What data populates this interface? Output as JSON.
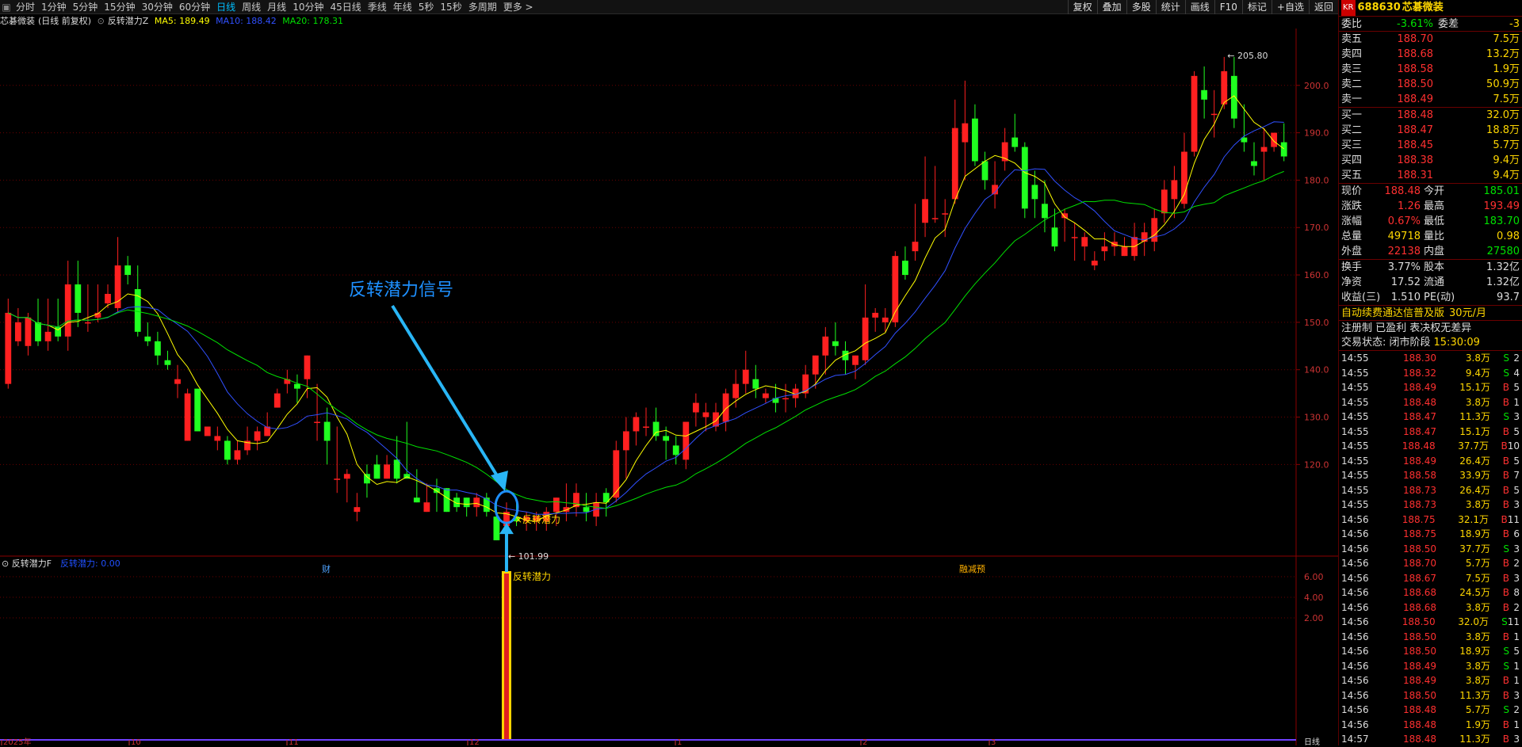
{
  "toolbar": {
    "timeframes": [
      "分时",
      "1分钟",
      "5分钟",
      "15分钟",
      "30分钟",
      "60分钟",
      "日线",
      "周线",
      "月线",
      "10分钟",
      "45日线",
      "季线",
      "年线",
      "5秒",
      "15秒",
      "多周期",
      "更多 >"
    ],
    "active_timeframe": "日线",
    "tools": [
      "复权",
      "叠加",
      "多股",
      "统计",
      "画线",
      "F10",
      "标记",
      "+自选",
      "返回"
    ]
  },
  "legend": {
    "stock_name": "芯碁微装",
    "mode": "(日线 前复权)",
    "indicator": "反转潜力Z",
    "ma5_label": "MA5: 189.49",
    "ma10_label": "MA10: 188.42",
    "ma20_label": "MA20: 178.31",
    "ma5_color": "#ffff00",
    "ma10_color": "#3050ff",
    "ma20_color": "#00e000"
  },
  "chart_data": {
    "type": "candlestick",
    "y_ticks": [
      "200.0",
      "190.0",
      "180.0",
      "170.0",
      "160.0",
      "150.0",
      "140.0",
      "130.0",
      "120.0"
    ],
    "ylim": [
      101,
      212
    ],
    "up_color": "#ff2020",
    "down_color": "#20ff20",
    "candles": [
      {
        "o": 137,
        "h": 155,
        "l": 136,
        "c": 152
      },
      {
        "o": 146,
        "h": 153,
        "l": 145,
        "c": 150
      },
      {
        "o": 145,
        "h": 152,
        "l": 143,
        "c": 151
      },
      {
        "o": 150,
        "h": 155,
        "l": 145,
        "c": 146
      },
      {
        "o": 146,
        "h": 155,
        "l": 144,
        "c": 148
      },
      {
        "o": 149,
        "h": 155,
        "l": 146,
        "c": 147
      },
      {
        "o": 147,
        "h": 163,
        "l": 144,
        "c": 158
      },
      {
        "o": 158,
        "h": 163,
        "l": 149,
        "c": 152
      },
      {
        "o": 150,
        "h": 158,
        "l": 148,
        "c": 150
      },
      {
        "o": 151,
        "h": 158,
        "l": 150,
        "c": 152
      },
      {
        "o": 154,
        "h": 158,
        "l": 153,
        "c": 156
      },
      {
        "o": 153,
        "h": 168,
        "l": 152,
        "c": 162
      },
      {
        "o": 162,
        "h": 164,
        "l": 158,
        "c": 160
      },
      {
        "o": 157,
        "h": 162,
        "l": 147,
        "c": 148
      },
      {
        "o": 147,
        "h": 150,
        "l": 145,
        "c": 146
      },
      {
        "o": 146,
        "h": 148,
        "l": 141,
        "c": 143
      },
      {
        "o": 142,
        "h": 144,
        "l": 140,
        "c": 141
      },
      {
        "o": 137,
        "h": 141,
        "l": 134,
        "c": 138
      },
      {
        "o": 125,
        "h": 136,
        "l": 125,
        "c": 135
      },
      {
        "o": 136,
        "h": 136,
        "l": 127,
        "c": 127
      },
      {
        "o": 126,
        "h": 128,
        "l": 127,
        "c": 128
      },
      {
        "o": 125,
        "h": 128,
        "l": 123,
        "c": 126
      },
      {
        "o": 125,
        "h": 126,
        "l": 120,
        "c": 121
      },
      {
        "o": 121,
        "h": 125,
        "l": 120,
        "c": 123
      },
      {
        "o": 123,
        "h": 128,
        "l": 122,
        "c": 125
      },
      {
        "o": 125,
        "h": 128,
        "l": 123,
        "c": 127
      },
      {
        "o": 126,
        "h": 131,
        "l": 126,
        "c": 128
      },
      {
        "o": 132,
        "h": 136,
        "l": 132,
        "c": 135
      },
      {
        "o": 137,
        "h": 140,
        "l": 135,
        "c": 138
      },
      {
        "o": 137,
        "h": 139,
        "l": 133,
        "c": 136
      },
      {
        "o": 138,
        "h": 143,
        "l": 134,
        "c": 143
      },
      {
        "o": 129,
        "h": 137,
        "l": 125,
        "c": 129
      },
      {
        "o": 129,
        "h": 132,
        "l": 120,
        "c": 125
      },
      {
        "o": 117,
        "h": 128,
        "l": 114,
        "c": 117
      },
      {
        "o": 117,
        "h": 119,
        "l": 112,
        "c": 118
      },
      {
        "o": 110,
        "h": 114,
        "l": 108,
        "c": 111
      },
      {
        "o": 118,
        "h": 120,
        "l": 113,
        "c": 116
      },
      {
        "o": 120,
        "h": 122,
        "l": 117,
        "c": 117
      },
      {
        "o": 117,
        "h": 122,
        "l": 117,
        "c": 120
      },
      {
        "o": 121,
        "h": 126,
        "l": 116,
        "c": 117
      },
      {
        "o": 118,
        "h": 129,
        "l": 117,
        "c": 117
      },
      {
        "o": 113,
        "h": 119,
        "l": 112,
        "c": 112
      },
      {
        "o": 110,
        "h": 116,
        "l": 110,
        "c": 112
      },
      {
        "o": 115,
        "h": 117,
        "l": 110,
        "c": 114
      },
      {
        "o": 115,
        "h": 115,
        "l": 110,
        "c": 110
      },
      {
        "o": 113,
        "h": 114,
        "l": 110,
        "c": 111
      },
      {
        "o": 113,
        "h": 113,
        "l": 109,
        "c": 111
      },
      {
        "o": 111,
        "h": 114,
        "l": 109,
        "c": 113
      },
      {
        "o": 113,
        "h": 114,
        "l": 109,
        "c": 110
      },
      {
        "o": 109,
        "h": 112,
        "l": 104,
        "c": 104
      },
      {
        "o": 107,
        "h": 112,
        "l": 102,
        "c": 110
      },
      {
        "o": 109,
        "h": 112,
        "l": 107,
        "c": 108
      },
      {
        "o": 108,
        "h": 110,
        "l": 106,
        "c": 109
      },
      {
        "o": 108,
        "h": 110,
        "l": 106,
        "c": 109
      },
      {
        "o": 108,
        "h": 111,
        "l": 106,
        "c": 110
      },
      {
        "o": 110,
        "h": 113,
        "l": 107,
        "c": 113
      },
      {
        "o": 110,
        "h": 116,
        "l": 108,
        "c": 111
      },
      {
        "o": 111,
        "h": 116,
        "l": 109,
        "c": 114
      },
      {
        "o": 111,
        "h": 114,
        "l": 108,
        "c": 110
      },
      {
        "o": 109,
        "h": 114,
        "l": 107,
        "c": 112
      },
      {
        "o": 114,
        "h": 115,
        "l": 109,
        "c": 112
      },
      {
        "o": 113,
        "h": 125,
        "l": 112,
        "c": 123
      },
      {
        "o": 123,
        "h": 130,
        "l": 117,
        "c": 127
      },
      {
        "o": 127,
        "h": 131,
        "l": 124,
        "c": 130
      },
      {
        "o": 128,
        "h": 132,
        "l": 126,
        "c": 128
      },
      {
        "o": 129,
        "h": 132,
        "l": 125,
        "c": 126
      },
      {
        "o": 126,
        "h": 128,
        "l": 121,
        "c": 125
      },
      {
        "o": 124,
        "h": 126,
        "l": 120,
        "c": 122
      },
      {
        "o": 121,
        "h": 127,
        "l": 119,
        "c": 129
      },
      {
        "o": 131,
        "h": 135,
        "l": 128,
        "c": 133
      },
      {
        "o": 130,
        "h": 133,
        "l": 127,
        "c": 131
      },
      {
        "o": 128,
        "h": 133,
        "l": 127,
        "c": 131
      },
      {
        "o": 129,
        "h": 136,
        "l": 127,
        "c": 135
      },
      {
        "o": 134,
        "h": 140,
        "l": 132,
        "c": 137
      },
      {
        "o": 137,
        "h": 144,
        "l": 135,
        "c": 140
      },
      {
        "o": 138,
        "h": 141,
        "l": 134,
        "c": 136
      },
      {
        "o": 134,
        "h": 136,
        "l": 133,
        "c": 135
      },
      {
        "o": 134,
        "h": 137,
        "l": 131,
        "c": 133
      },
      {
        "o": 134,
        "h": 137,
        "l": 131,
        "c": 134
      },
      {
        "o": 134,
        "h": 137,
        "l": 132,
        "c": 136
      },
      {
        "o": 135,
        "h": 141,
        "l": 134,
        "c": 139
      },
      {
        "o": 139,
        "h": 143,
        "l": 136,
        "c": 143
      },
      {
        "o": 143,
        "h": 149,
        "l": 139,
        "c": 147
      },
      {
        "o": 146,
        "h": 150,
        "l": 143,
        "c": 145
      },
      {
        "o": 144,
        "h": 146,
        "l": 139,
        "c": 142
      },
      {
        "o": 141,
        "h": 143,
        "l": 138,
        "c": 143
      },
      {
        "o": 142,
        "h": 158,
        "l": 141,
        "c": 151
      },
      {
        "o": 151,
        "h": 153,
        "l": 148,
        "c": 152
      },
      {
        "o": 150,
        "h": 153,
        "l": 148,
        "c": 151
      },
      {
        "o": 150,
        "h": 165,
        "l": 149,
        "c": 164
      },
      {
        "o": 163,
        "h": 166,
        "l": 159,
        "c": 160
      },
      {
        "o": 165,
        "h": 175,
        "l": 163,
        "c": 167
      },
      {
        "o": 171,
        "h": 185,
        "l": 168,
        "c": 176
      },
      {
        "o": 172,
        "h": 183,
        "l": 171,
        "c": 172
      },
      {
        "o": 173,
        "h": 176,
        "l": 168,
        "c": 173
      },
      {
        "o": 176,
        "h": 197,
        "l": 175,
        "c": 191
      },
      {
        "o": 188,
        "h": 201,
        "l": 180,
        "c": 192
      },
      {
        "o": 193,
        "h": 196,
        "l": 183,
        "c": 184
      },
      {
        "o": 184,
        "h": 186,
        "l": 178,
        "c": 180
      },
      {
        "o": 177,
        "h": 184,
        "l": 174,
        "c": 179
      },
      {
        "o": 184,
        "h": 191,
        "l": 182,
        "c": 188
      },
      {
        "o": 189,
        "h": 194,
        "l": 186,
        "c": 187
      },
      {
        "o": 187,
        "h": 188,
        "l": 172,
        "c": 174
      },
      {
        "o": 179,
        "h": 182,
        "l": 172,
        "c": 176
      },
      {
        "o": 175,
        "h": 180,
        "l": 169,
        "c": 172
      },
      {
        "o": 170,
        "h": 174,
        "l": 165,
        "c": 166
      },
      {
        "o": 172,
        "h": 174,
        "l": 167,
        "c": 173
      },
      {
        "o": 168,
        "h": 171,
        "l": 163,
        "c": 168
      },
      {
        "o": 166,
        "h": 169,
        "l": 163,
        "c": 168
      },
      {
        "o": 162,
        "h": 165,
        "l": 161,
        "c": 163
      },
      {
        "o": 165,
        "h": 169,
        "l": 163,
        "c": 166
      },
      {
        "o": 166,
        "h": 169,
        "l": 164,
        "c": 167
      },
      {
        "o": 164,
        "h": 168,
        "l": 164,
        "c": 166
      },
      {
        "o": 164,
        "h": 171,
        "l": 163,
        "c": 168
      },
      {
        "o": 167,
        "h": 171,
        "l": 164,
        "c": 169
      },
      {
        "o": 167,
        "h": 174,
        "l": 165,
        "c": 172
      },
      {
        "o": 173,
        "h": 180,
        "l": 171,
        "c": 178
      },
      {
        "o": 176,
        "h": 183,
        "l": 172,
        "c": 180
      },
      {
        "o": 175,
        "h": 190,
        "l": 174,
        "c": 186
      },
      {
        "o": 186,
        "h": 203,
        "l": 185,
        "c": 202
      },
      {
        "o": 199,
        "h": 204,
        "l": 193,
        "c": 197
      },
      {
        "o": 194,
        "h": 199,
        "l": 189,
        "c": 194
      },
      {
        "o": 196,
        "h": 206,
        "l": 195,
        "c": 203
      },
      {
        "o": 202,
        "h": 206,
        "l": 191,
        "c": 193
      },
      {
        "o": 189,
        "h": 196,
        "l": 186,
        "c": 188
      },
      {
        "o": 184,
        "h": 188,
        "l": 181,
        "c": 183
      },
      {
        "o": 186,
        "h": 191,
        "l": 180,
        "c": 187
      },
      {
        "o": 187,
        "h": 190,
        "l": 186,
        "c": 190
      },
      {
        "o": 188,
        "h": 192,
        "l": 184,
        "c": 185
      }
    ],
    "candle_note": "approx daily OHLC read from chart",
    "high_label": "205.80",
    "low_label": "101.99",
    "annotation": "反转潜力信号",
    "signal_label": "反转潜力",
    "event_markers": [
      "财",
      "融减预"
    ],
    "sub_title": "反转潜力F",
    "sub_value_label": "反转潜力: 0.00",
    "sub_ticks": [
      "6.00",
      "4.00",
      "2.00"
    ],
    "x_labels": [
      "2025年",
      "10",
      "11",
      "12",
      "1",
      "2",
      "3"
    ],
    "corner_label": "日线"
  },
  "quote": {
    "header": {
      "badge": "KR",
      "code": "688630",
      "name": "芯碁微装"
    },
    "wb": {
      "label": "委比",
      "value": "-3.61%",
      "diff_label": "委差",
      "diff": "-3"
    },
    "asks": [
      {
        "label": "卖五",
        "price": "188.70",
        "vol": "7.5万"
      },
      {
        "label": "卖四",
        "price": "188.68",
        "vol": "13.2万"
      },
      {
        "label": "卖三",
        "price": "188.58",
        "vol": "1.9万"
      },
      {
        "label": "卖二",
        "price": "188.50",
        "vol": "50.9万"
      },
      {
        "label": "卖一",
        "price": "188.49",
        "vol": "7.5万"
      }
    ],
    "bids": [
      {
        "label": "买一",
        "price": "188.48",
        "vol": "32.0万"
      },
      {
        "label": "买二",
        "price": "188.47",
        "vol": "18.8万"
      },
      {
        "label": "买三",
        "price": "188.45",
        "vol": "5.7万"
      },
      {
        "label": "买四",
        "price": "188.38",
        "vol": "9.4万"
      },
      {
        "label": "买五",
        "price": "188.31",
        "vol": "9.4万"
      }
    ],
    "stats": [
      {
        "a": "现价",
        "av": "188.48",
        "ac": "red",
        "b": "今开",
        "bv": "185.01",
        "bc": "green"
      },
      {
        "a": "涨跌",
        "av": "1.26",
        "ac": "red",
        "b": "最高",
        "bv": "193.49",
        "bc": "red"
      },
      {
        "a": "涨幅",
        "av": "0.67%",
        "ac": "red",
        "b": "最低",
        "bv": "183.70",
        "bc": "green"
      },
      {
        "a": "总量",
        "av": "49718",
        "ac": "yel",
        "b": "量比",
        "bv": "0.98",
        "bc": "yel"
      },
      {
        "a": "外盘",
        "av": "22138",
        "ac": "red",
        "b": "内盘",
        "bv": "27580",
        "bc": "green"
      }
    ],
    "stats2": [
      {
        "a": "换手",
        "av": "3.77%",
        "b": "股本",
        "bv": "1.32亿"
      },
      {
        "a": "净资",
        "av": "17.52",
        "b": "流通",
        "bv": "1.32亿"
      },
      {
        "a": "收益(三)",
        "av": "1.510",
        "b": "PE(动)",
        "bv": "93.7"
      }
    ],
    "promo": "自动续费通达信普及版",
    "promo_price": "30元/月",
    "reg": "注册制 已盈利 表决权无差异",
    "status_label": "交易状态: 闭市阶段",
    "status_time": "15:30:09",
    "ticks": [
      [
        "14:55",
        "188.30",
        "3.8万",
        "S",
        "2"
      ],
      [
        "14:55",
        "188.32",
        "9.4万",
        "S",
        "4"
      ],
      [
        "14:55",
        "188.49",
        "15.1万",
        "B",
        "5"
      ],
      [
        "14:55",
        "188.48",
        "3.8万",
        "B",
        "1"
      ],
      [
        "14:55",
        "188.47",
        "11.3万",
        "S",
        "3"
      ],
      [
        "14:55",
        "188.47",
        "15.1万",
        "B",
        "5"
      ],
      [
        "14:55",
        "188.48",
        "37.7万",
        "B",
        "10"
      ],
      [
        "14:55",
        "188.49",
        "26.4万",
        "B",
        "5"
      ],
      [
        "14:55",
        "188.58",
        "33.9万",
        "B",
        "7"
      ],
      [
        "14:55",
        "188.73",
        "26.4万",
        "B",
        "5"
      ],
      [
        "14:55",
        "188.73",
        "3.8万",
        "B",
        "3"
      ],
      [
        "14:56",
        "188.75",
        "32.1万",
        "B",
        "11"
      ],
      [
        "14:56",
        "188.75",
        "18.9万",
        "B",
        "6"
      ],
      [
        "14:56",
        "188.50",
        "37.7万",
        "S",
        "3"
      ],
      [
        "14:56",
        "188.70",
        "5.7万",
        "B",
        "2"
      ],
      [
        "14:56",
        "188.67",
        "7.5万",
        "B",
        "3"
      ],
      [
        "14:56",
        "188.68",
        "24.5万",
        "B",
        "8"
      ],
      [
        "14:56",
        "188.68",
        "3.8万",
        "B",
        "2"
      ],
      [
        "14:56",
        "188.50",
        "32.0万",
        "S",
        "11"
      ],
      [
        "14:56",
        "188.50",
        "3.8万",
        "B",
        "1"
      ],
      [
        "14:56",
        "188.50",
        "18.9万",
        "S",
        "5"
      ],
      [
        "14:56",
        "188.49",
        "3.8万",
        "S",
        "1"
      ],
      [
        "14:56",
        "188.49",
        "3.8万",
        "B",
        "1"
      ],
      [
        "14:56",
        "188.50",
        "11.3万",
        "B",
        "3"
      ],
      [
        "14:56",
        "188.48",
        "5.7万",
        "S",
        "2"
      ],
      [
        "14:56",
        "188.48",
        "1.9万",
        "B",
        "1"
      ],
      [
        "14:57",
        "188.48",
        "11.3万",
        "B",
        "3"
      ]
    ]
  }
}
